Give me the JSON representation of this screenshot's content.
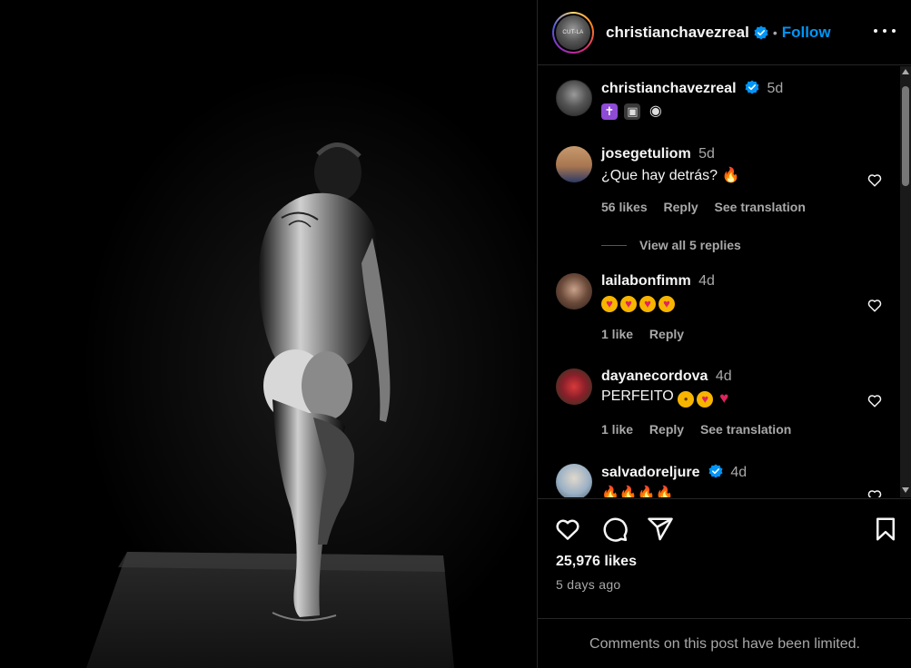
{
  "header": {
    "username": "christianchavezreal",
    "follow_label": "Follow",
    "separator": "•",
    "avatar_text": "CUT-LA"
  },
  "caption": {
    "username": "christianchavezreal",
    "time": "5d",
    "emojis": [
      "latin-cross",
      "television",
      "eye"
    ]
  },
  "comments": [
    {
      "username": "josegetuliom",
      "time": "5d",
      "text": "¿Que hay detrás?",
      "emoji": "fire",
      "likes": "56 likes",
      "reply": "Reply",
      "translate": "See translation",
      "view_replies": "View all 5 replies"
    },
    {
      "username": "lailabonfimm",
      "time": "4d",
      "text": "",
      "emojis": [
        "heart-eyes",
        "heart-eyes",
        "heart-eyes",
        "heart-eyes"
      ],
      "likes": "1 like",
      "reply": "Reply"
    },
    {
      "username": "dayanecordova",
      "time": "4d",
      "text": "PERFEITO",
      "emojis": [
        "pleading-face",
        "heart-eyes",
        "red-heart"
      ],
      "likes": "1 like",
      "reply": "Reply",
      "translate": "See translation"
    },
    {
      "username": "salvadoreljure",
      "time": "4d",
      "emojis": [
        "fire",
        "fire",
        "fire",
        "fire"
      ]
    }
  ],
  "footer": {
    "likes": "25,976 likes",
    "time_ago": "5 days ago",
    "limited_notice": "Comments on this post have been limited."
  },
  "colors": {
    "accent": "#0095f6",
    "verified": "#0095f6",
    "muted": "#a8a8a8",
    "background": "#000000",
    "border": "#262626"
  }
}
